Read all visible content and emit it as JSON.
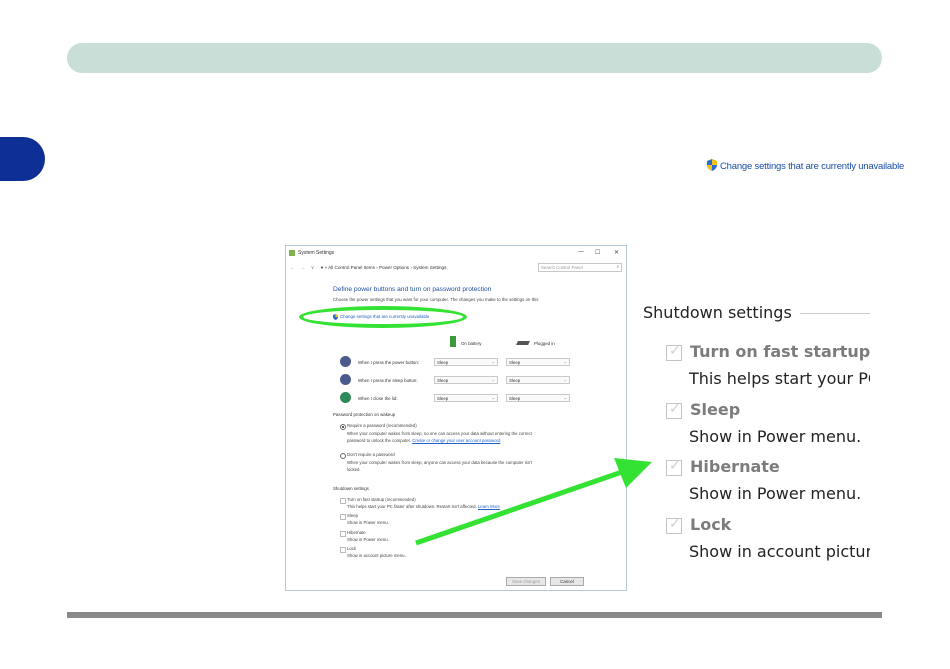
{
  "callout": {
    "link_text": "Change settings that are currently unavailable"
  },
  "window": {
    "title": "System Settings",
    "controls": {
      "minimize": "—",
      "maximize": "☐",
      "close": "✕"
    },
    "nav": "←  →  ∨  ↑",
    "breadcrumb": "▾  «  All Control Panel Items  ›  Power Options  ›  System Settings",
    "search_placeholder": "Search Control Panel",
    "heading": "Define power buttons and turn on password protection",
    "description": "Choose the power settings that you want for your computer. The changes you make to the settings on this",
    "change_link": "Change settings that are currently unavailable",
    "columns": {
      "battery": "On battery",
      "plugged": "Plugged in"
    },
    "rows": [
      {
        "label": "When I press the power button:",
        "battery": "Sleep",
        "plugged": "Sleep"
      },
      {
        "label": "When I press the sleep button:",
        "battery": "Sleep",
        "plugged": "Sleep"
      },
      {
        "label": "When I close the lid:",
        "battery": "Sleep",
        "plugged": "Sleep"
      }
    ],
    "password_section": "Password protection on wakeup",
    "require_password": {
      "label": "Require a password (recommended)",
      "desc1": "When your computer wakes from sleep, no one can access your data without entering the correct",
      "desc2": "password to unlock the computer.",
      "link": "Create or change your user account password"
    },
    "no_password": {
      "label": "Don't require a password",
      "desc1": "When your computer wakes from sleep, anyone can access your data because the computer isn't",
      "desc2": "locked."
    },
    "shutdown_section": "Shutdown settings",
    "shutdown": [
      {
        "label": "Turn on fast startup (recommended)",
        "desc": "This helps start your PC faster after shutdown. Restart isn't affected.",
        "link": "Learn More"
      },
      {
        "label": "Sleep",
        "desc": "Show in Power menu."
      },
      {
        "label": "Hibernate",
        "desc": "Show in Power menu."
      },
      {
        "label": "Lock",
        "desc": "Show in account picture menu."
      }
    ],
    "save_button": "Save changes",
    "cancel_button": "Cancel"
  },
  "zoom": {
    "heading": "Shutdown settings",
    "items": [
      {
        "label": "Turn on fast startup (",
        "desc": "This helps start your PC"
      },
      {
        "label": "Sleep",
        "desc": "Show in Power menu."
      },
      {
        "label": "Hibernate",
        "desc": "Show in Power menu."
      },
      {
        "label": "Lock",
        "desc": "Show in account pictur"
      }
    ]
  },
  "colors": {
    "header_bar": "#c8ded7",
    "side_tab": "#0d2f96",
    "highlight": "#33e233",
    "link": "#1a4ea8"
  }
}
